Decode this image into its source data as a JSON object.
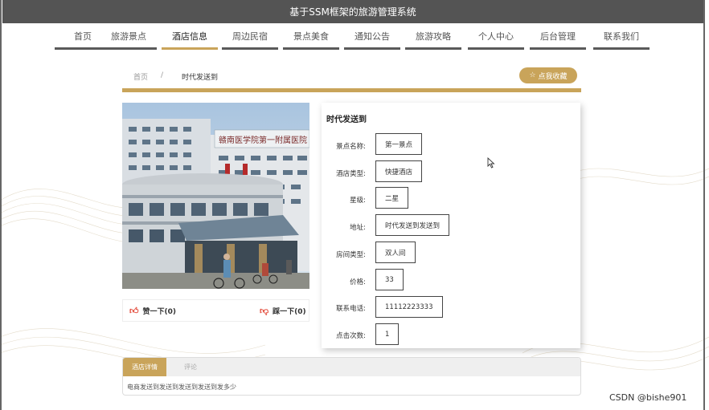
{
  "window": {
    "title": "基于SSM框架的旅游管理系统"
  },
  "nav": {
    "items": [
      {
        "label": "首页",
        "active": false
      },
      {
        "label": "旅游景点",
        "active": false
      },
      {
        "label": "酒店信息",
        "active": true
      },
      {
        "label": "周边民宿",
        "active": false
      },
      {
        "label": "景点美食",
        "active": false
      },
      {
        "label": "通知公告",
        "active": false
      },
      {
        "label": "旅游攻略",
        "active": false
      },
      {
        "label": "个人中心",
        "active": false
      },
      {
        "label": "后台管理",
        "active": false
      },
      {
        "label": "联系我们",
        "active": false
      }
    ]
  },
  "breadcrumb": {
    "home": "首页",
    "separator": "/",
    "current": "时代发送到"
  },
  "favorite": {
    "label": "点我收藏",
    "icon": "star-icon"
  },
  "photo": {
    "sign_text": "赣南医学院第一附属医院"
  },
  "votes": {
    "like_label": "赞一下(0)",
    "dislike_label": "踩一下(0)",
    "like_icon": "thumbs-up-icon",
    "dislike_icon": "thumbs-down-icon"
  },
  "detail": {
    "title": "时代发送到",
    "fields": [
      {
        "label": "景点名称:",
        "value": "第一景点"
      },
      {
        "label": "酒店类型:",
        "value": "快捷酒店"
      },
      {
        "label": "星级:",
        "value": "二星"
      },
      {
        "label": "地址:",
        "value": "时代发送到发送到"
      },
      {
        "label": "房间类型:",
        "value": "双人间"
      },
      {
        "label": "价格:",
        "value": "33"
      },
      {
        "label": "联系电话:",
        "value": "11112223333"
      },
      {
        "label": "点击次数:",
        "value": "1"
      }
    ]
  },
  "tabs": {
    "items": [
      {
        "label": "酒店详情"
      },
      {
        "label": "评论"
      }
    ],
    "content": "电商发送到发送到发送到发送到发多少"
  },
  "watermark": "CSDN @bishe901",
  "colors": {
    "accent": "#c9a45a",
    "titlebar": "#545454",
    "nav_underline": "#5a5a5a"
  }
}
